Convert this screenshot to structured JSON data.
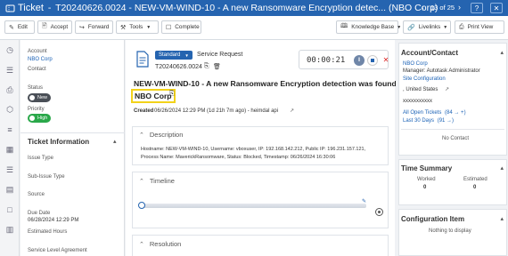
{
  "title_bar": {
    "label": "Ticket",
    "title": "T20240626.0024 - NEW-VM-WIND-10 - A new Ransomware Encryption detec... (NBO Corp)",
    "pager": "13 of 25"
  },
  "toolbar": {
    "edit": "Edit",
    "accept": "Accept",
    "forward": "Forward",
    "tools": "Tools",
    "complete": "Complete",
    "knowledge_base": "Knowledge Base",
    "livelinks": "Livelinks",
    "print_view": "Print View"
  },
  "left": {
    "account_label": "Account",
    "account_value": "NBO Corp",
    "contact_label": "Contact",
    "status_label": "Status",
    "status_value": "New",
    "priority_label": "Priority",
    "priority_value": "High",
    "ticket_info_heading": "Ticket Information",
    "issue_type": "Issue Type",
    "sub_issue_type": "Sub-Issue Type",
    "source": "Source",
    "due_date_label": "Due Date",
    "due_date_value": "06/28/2024 12:29 PM",
    "estimated_hours": "Estimated Hours",
    "sla": "Service Level Agreement"
  },
  "main": {
    "standard": "Standard",
    "ticket_type": "Service Request",
    "ticket_number": "T20240626.0024",
    "timer": "00:00:21",
    "heading": "NEW-VM-WIND-10 - A new Ransomware Encryption detection was found -",
    "heading_account": "NBO Corp",
    "created_label": "Created",
    "created_value": "06/26/2024 12:29 PM (1d 21h 7m ago) - heimdal api",
    "description_heading": "Description",
    "description_line1": "Hostname: NEW-VM-WIND-10, Username: vboxuser, IP: 192.168.142.212, Public IP: 196.231.157.121,",
    "description_line2": "Process Name: MaverickRansomware, Status: Blocked, Timestamp: 06/26/2024 16:30:06",
    "timeline_heading": "Timeline",
    "resolution_heading": "Resolution"
  },
  "right": {
    "account_contact_heading": "Account/Contact",
    "account_name": "NBO Corp",
    "manager": "Manager: Autotask Administrator",
    "site_configuration": "Site Configuration",
    "country": ", United States",
    "masked_phone": "xxxxxxxxxxx",
    "open_tickets": "All Open Tickets",
    "open_tickets_count": "(84",
    "last_30_days": "Last 30 Days",
    "last_30_count": "(91",
    "no_contact": "No Contact",
    "time_summary_heading": "Time Summary",
    "worked_label": "Worked",
    "worked_value": "0",
    "estimated_label": "Estimated",
    "estimated_value": "0",
    "config_item_heading": "Configuration Item",
    "nothing_to_display": "Nothing to display"
  },
  "colors": {
    "brand_blue": "#2564b0",
    "status_new": "#4a4f57",
    "priority_high": "#2aa84a",
    "highlight": "#f2d21a"
  }
}
